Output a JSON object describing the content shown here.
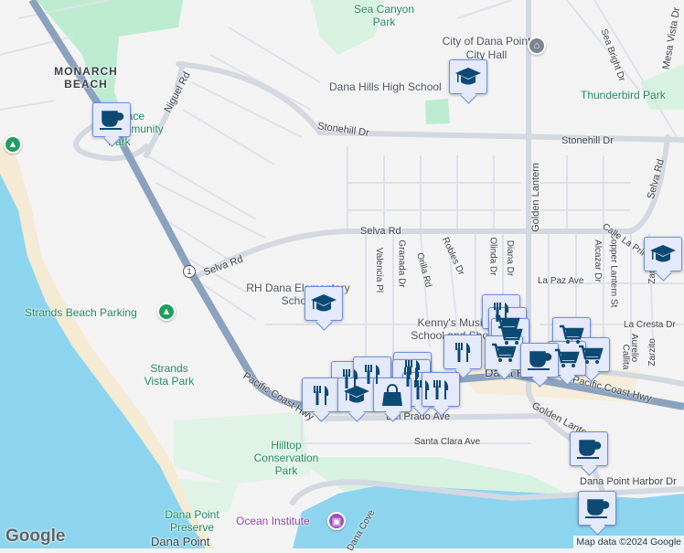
{
  "map": {
    "colors": {
      "water": "#8dd5ee",
      "park": "#bdebd0",
      "highway": "#8aa2bd",
      "road": "#d8dce4",
      "land": "#f4f3f4",
      "marker_fill": "#e4eafc",
      "marker_border": "#6c8ee0",
      "icon": "#0d4a73"
    },
    "areas": [
      "MONARCH BEACH",
      "Dana Point"
    ],
    "parks": [
      "Sea Canyon Park",
      "Thunderbird Park",
      "Terrace Community Park",
      "Strands Vista Park",
      "Hilltop Conservation Park",
      "Dana Point Preserve"
    ],
    "streets": [
      "Stonehill Dr",
      "Stonehill Dr",
      "Selva Rd",
      "Selva Rd",
      "Selva Rd",
      "Niguel Rd",
      "Golden Lantern",
      "Pacific Coast Hwy",
      "Pacific Coast Hwy",
      "Del Prado Ave",
      "Santa Clara Ave",
      "Dana Point Harbor Dr",
      "Golden Lantern",
      "La Paz Ave",
      "La Cresta Dr",
      "Sea Bright Dr",
      "Mesa Vista Dr",
      "Alcazar Dr",
      "Copper Lantern St",
      "Aurelio",
      "Callita",
      "Zarzito",
      "Zarzito",
      "Valencia Pl",
      "Granada Dr",
      "Orilla Rd",
      "Robles Dr",
      "Olinda Dr",
      "Diana Dr",
      "Calle La Primavera",
      "Dana Cove"
    ],
    "pois": [
      "City of Dana Point City Hall",
      "Dana Hills High School",
      "RH Dana Elementary School",
      "Kenny's Music School and Shop",
      "Strands Beach Parking",
      "Ocean Institute"
    ],
    "route_shields": [
      "1",
      "1"
    ],
    "marker_icons": [
      "coffee-cup",
      "graduation-cap",
      "fork-knife",
      "shopping-cart",
      "shopping-bag"
    ],
    "logo": "Google",
    "attribution": "Map data ©2024 Google"
  }
}
